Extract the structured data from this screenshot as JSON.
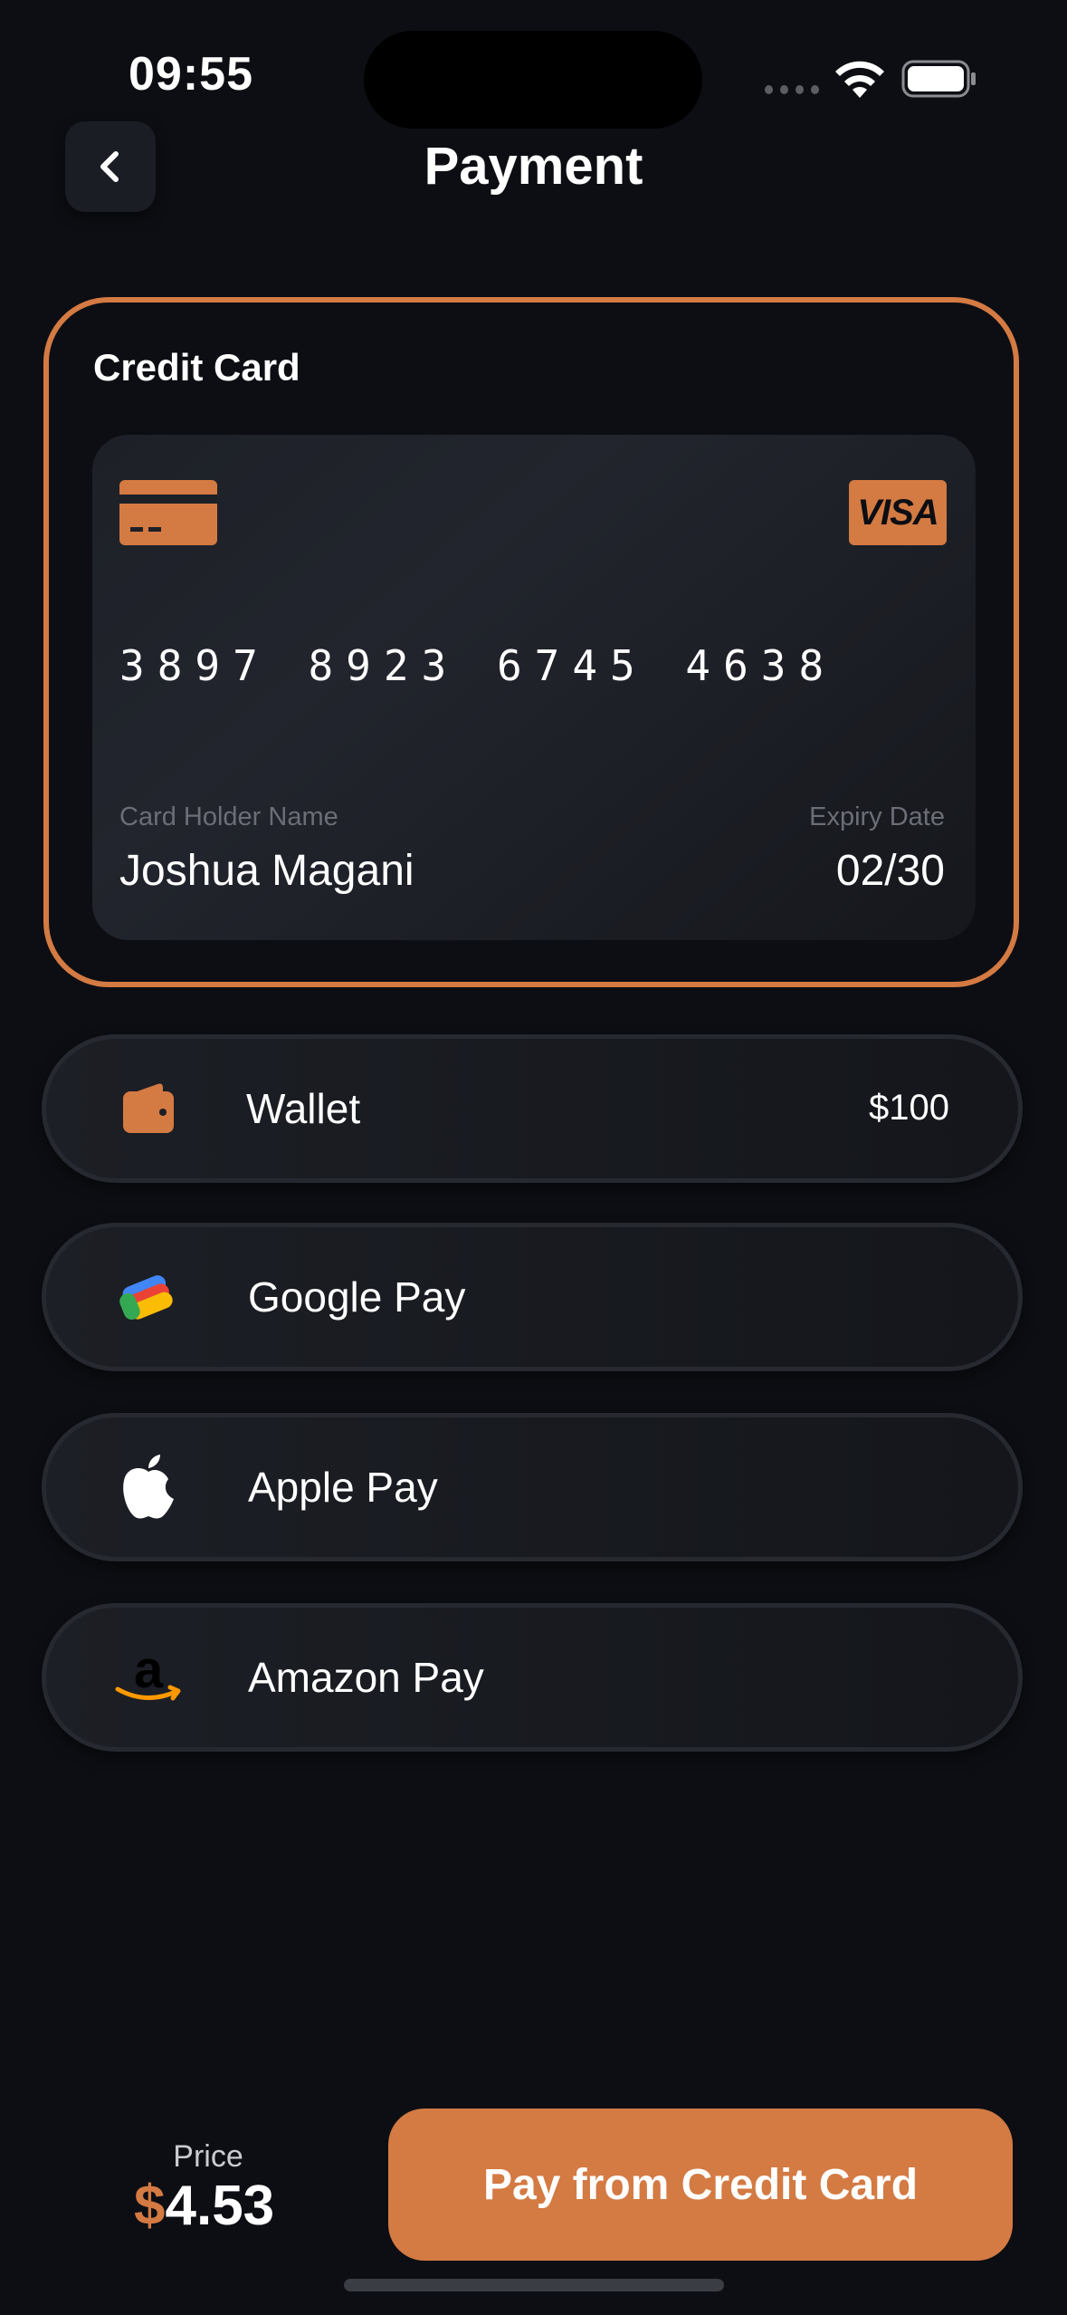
{
  "status_bar": {
    "time": "09:55"
  },
  "header": {
    "title": "Payment"
  },
  "credit_card": {
    "section_title": "Credit Card",
    "brand": "VISA",
    "number": "3897 8923 6745 4638",
    "holder_label": "Card Holder Name",
    "holder_name": "Joshua Magani",
    "expiry_label": "Expiry Date",
    "expiry_value": "02/30"
  },
  "methods": [
    {
      "label": "Wallet",
      "value": "$100",
      "icon": "wallet-icon"
    },
    {
      "label": "Google Pay",
      "icon": "google-pay-icon"
    },
    {
      "label": "Apple Pay",
      "icon": "apple-icon"
    },
    {
      "label": "Amazon Pay",
      "icon": "amazon-icon"
    }
  ],
  "footer": {
    "price_label": "Price",
    "price_currency": "$",
    "price_amount": "4.53",
    "pay_button": "Pay from Credit Card"
  },
  "colors": {
    "accent": "#d47a43",
    "background": "#0c0e13",
    "card": "#1d2027"
  }
}
